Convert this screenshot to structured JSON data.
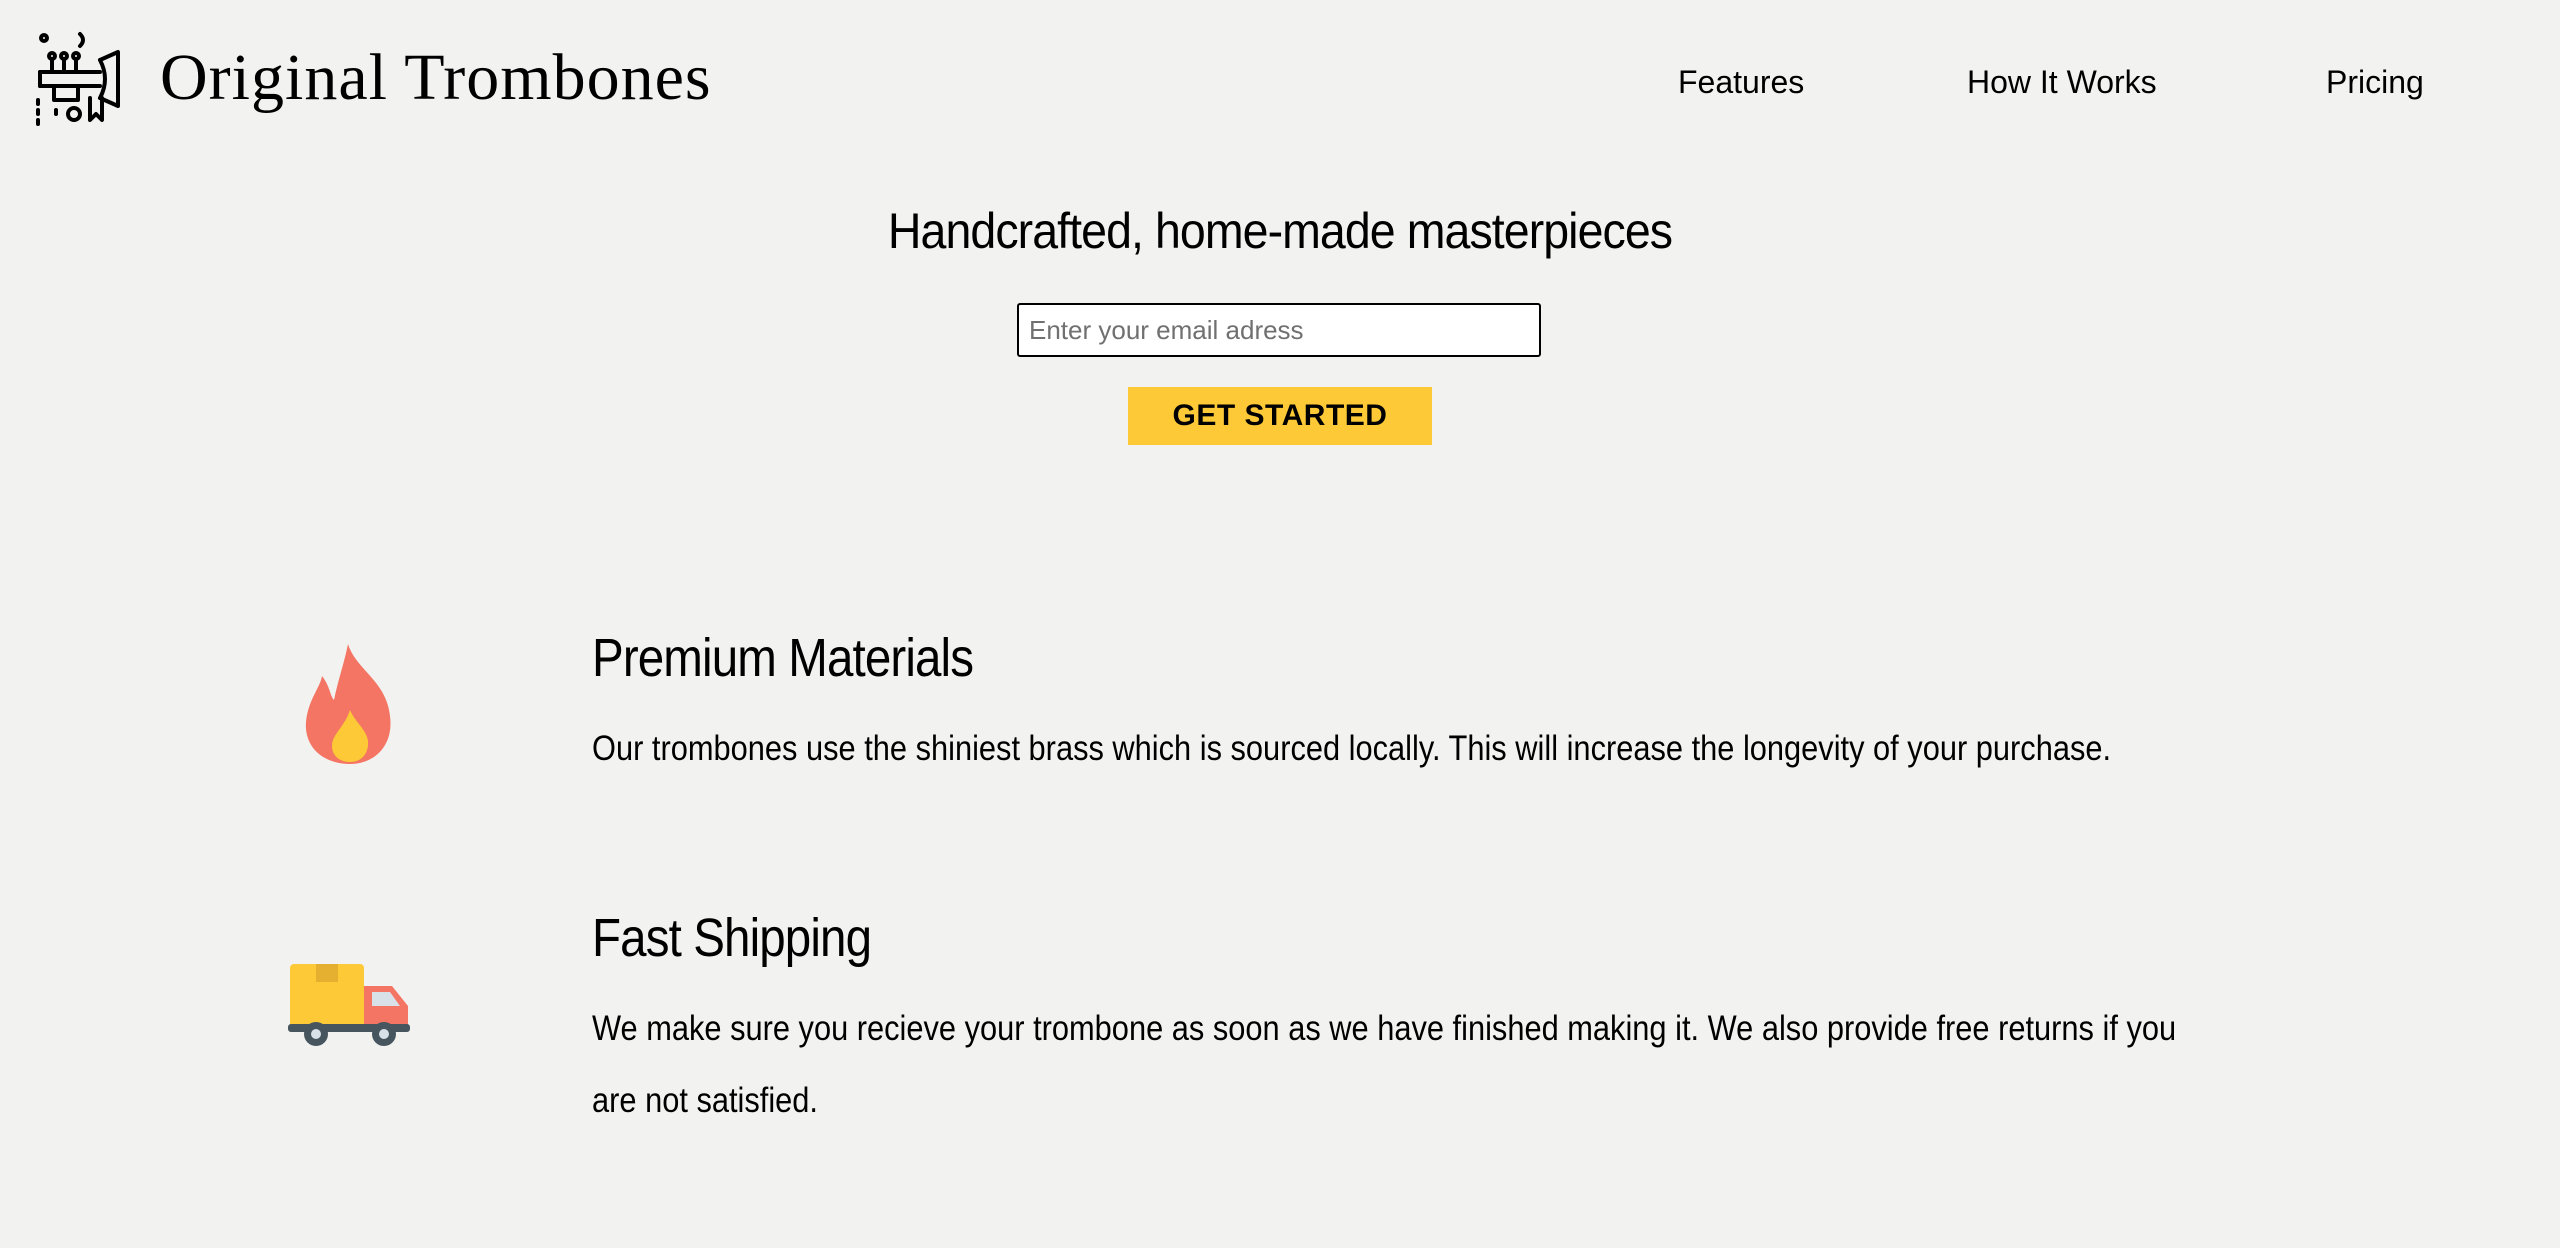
{
  "brand": {
    "name": "Original Trombones",
    "logo_icon": "trombone-logo-icon"
  },
  "nav": {
    "items": [
      {
        "label": "Features"
      },
      {
        "label": "How It Works"
      },
      {
        "label": "Pricing"
      }
    ]
  },
  "hero": {
    "title": "Handcrafted, home-made masterpieces",
    "email_placeholder": "Enter your email adress",
    "email_value": "",
    "cta_label": "GET STARTED"
  },
  "features": [
    {
      "icon": "fire-icon",
      "title": "Premium Materials",
      "description": "Our trombones use the shiniest brass which is sourced locally. This will increase the longevity of your purchase."
    },
    {
      "icon": "delivery-truck-icon",
      "title": "Fast Shipping",
      "description": "We make sure you recieve your trombone as soon as we have finished making it. We also provide free returns if you are not satisfied."
    }
  ],
  "colors": {
    "background": "#f2f2f1",
    "cta": "#fdc936",
    "fire_outer": "#f47563",
    "fire_inner": "#fdc936",
    "truck_box": "#fdc936",
    "truck_cab": "#f47563",
    "truck_wheels": "#47555f"
  }
}
